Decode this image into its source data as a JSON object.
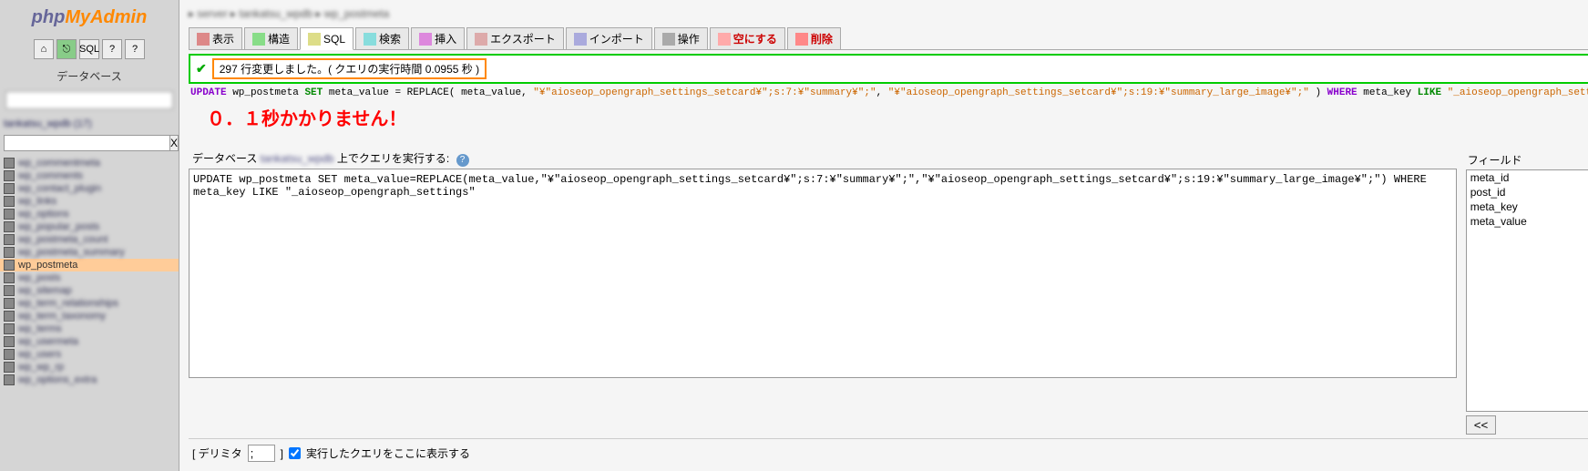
{
  "logo": {
    "php": "php",
    "my": "My",
    "admin": "Admin"
  },
  "sidebar": {
    "db_label": "データベース",
    "search_x": "X",
    "tables": [
      {
        "label": "wp_commentmeta",
        "blurred": true
      },
      {
        "label": "wp_comments",
        "blurred": true
      },
      {
        "label": "wp_contact_plugin",
        "blurred": true
      },
      {
        "label": "wp_links",
        "blurred": true
      },
      {
        "label": "wp_options",
        "blurred": true
      },
      {
        "label": "wp_popular_posts",
        "blurred": true
      },
      {
        "label": "wp_postmeta_count",
        "blurred": true
      },
      {
        "label": "wp_postmeta_summary",
        "blurred": true
      },
      {
        "label": "wp_postmeta",
        "blurred": false,
        "active": true
      },
      {
        "label": "wp_posts",
        "blurred": true
      },
      {
        "label": "wp_sitemap",
        "blurred": true
      },
      {
        "label": "wp_term_relationships",
        "blurred": true
      },
      {
        "label": "wp_term_taxonomy",
        "blurred": true
      },
      {
        "label": "wp_terms",
        "blurred": true
      },
      {
        "label": "wp_usermeta",
        "blurred": true
      },
      {
        "label": "wp_users",
        "blurred": true
      },
      {
        "label": "wp_wp_rp",
        "blurred": true
      },
      {
        "label": "wp_options_extra",
        "blurred": true
      }
    ]
  },
  "tabs": [
    {
      "id": "browse",
      "label": "表示",
      "icon": "ti-browse"
    },
    {
      "id": "structure",
      "label": "構造",
      "icon": "ti-struct"
    },
    {
      "id": "sql",
      "label": "SQL",
      "icon": "ti-sql",
      "active": true
    },
    {
      "id": "search",
      "label": "検索",
      "icon": "ti-search"
    },
    {
      "id": "insert",
      "label": "挿入",
      "icon": "ti-insert"
    },
    {
      "id": "export",
      "label": "エクスポート",
      "icon": "ti-export"
    },
    {
      "id": "import",
      "label": "インポート",
      "icon": "ti-import"
    },
    {
      "id": "operations",
      "label": "操作",
      "icon": "ti-ops"
    },
    {
      "id": "empty",
      "label": "空にする",
      "icon": "ti-empty",
      "red": true
    },
    {
      "id": "drop",
      "label": "削除",
      "icon": "ti-drop",
      "red": true
    }
  ],
  "success": {
    "check": "✔",
    "message": "297 行変更しました。( クエリの実行時間 0.0955 秒 )"
  },
  "sql_parts": {
    "update": "UPDATE",
    "table": " wp_postmeta ",
    "set": "SET",
    "col": " meta_value = ",
    "func": "REPLACE( meta_value, ",
    "str1": "\"¥\"aioseop_opengraph_settings_setcard¥\";s:7:¥\"summary¥\";\"",
    "comma": ", ",
    "str2": "\"¥\"aioseop_opengraph_settings_setcard¥\";s:19:¥\"summary_large_image¥\";\"",
    "close": " ) ",
    "where": "WHERE",
    "col2": " meta_key ",
    "like": "LIKE",
    "str3": " \"_aioseop_opengraph_settings\";"
  },
  "annotation": "０．１秒かかりません！",
  "query": {
    "label_prefix": "データベース",
    "label_db": "tankatsu_wpdb",
    "label_suffix": " 上でクエリを実行する:",
    "help": "?",
    "textarea_value": "UPDATE wp_postmeta SET meta_value=REPLACE(meta_value,\"¥\"aioseop_opengraph_settings_setcard¥\";s:7:¥\"summary¥\";\",\"¥\"aioseop_opengraph_settings_setcard¥\";s:19:¥\"summary_large_image¥\";\") WHERE meta_key LIKE \"_aioseop_opengraph_settings\""
  },
  "fields": {
    "label": "フィールド",
    "items": [
      "meta_id",
      "post_id",
      "meta_key",
      "meta_value"
    ],
    "button": "<<"
  },
  "bottom": {
    "delim_label_open": "[ デリミタ",
    "delim_value": ";",
    "delim_label_close": "]",
    "checkbox_label": "実行したクエリをここに表示する"
  }
}
